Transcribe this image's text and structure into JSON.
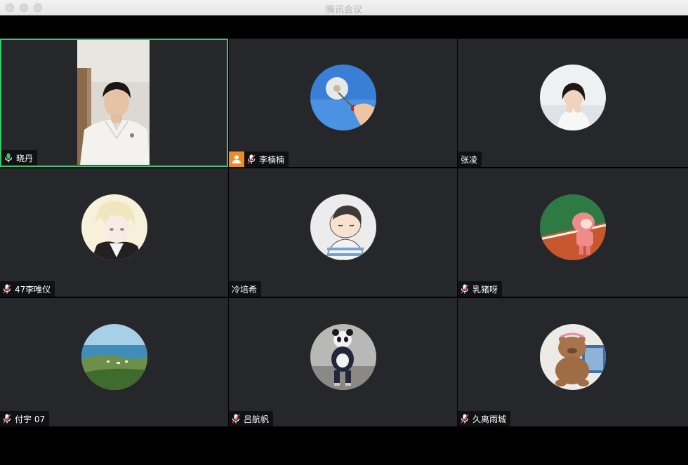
{
  "window": {
    "title": "腾讯会议"
  },
  "participants": [
    {
      "name": "晓丹",
      "mic": "on",
      "active": true,
      "avatar": "camera-video"
    },
    {
      "name": "李楠楠",
      "mic": "muted",
      "active": false,
      "avatar": "dandelion-avatar",
      "badge": "screen-share-icon"
    },
    {
      "name": "张凌",
      "mic": "none",
      "active": false,
      "avatar": "girl-photo-avatar"
    },
    {
      "name": "47李唯仪",
      "mic": "muted",
      "active": false,
      "avatar": "anime-boy-avatar"
    },
    {
      "name": "冷培希",
      "mic": "none",
      "active": false,
      "avatar": "cartoon-boy-avatar"
    },
    {
      "name": "乳猪呀",
      "mic": "muted",
      "active": false,
      "avatar": "pink-cartoon-avatar"
    },
    {
      "name": "付宇 07",
      "mic": "muted",
      "active": false,
      "avatar": "coast-landscape-avatar"
    },
    {
      "name": "吕航帆",
      "mic": "muted",
      "active": false,
      "avatar": "panda-costume-avatar"
    },
    {
      "name": "久离雨城",
      "mic": "muted",
      "active": false,
      "avatar": "bear-avatar"
    }
  ],
  "colors": {
    "active_border": "#35c86d",
    "mic_on": "#35c86d",
    "mic_muted": "#e0424a",
    "badge": "#f08a25",
    "tile_bg": "#25272b"
  }
}
